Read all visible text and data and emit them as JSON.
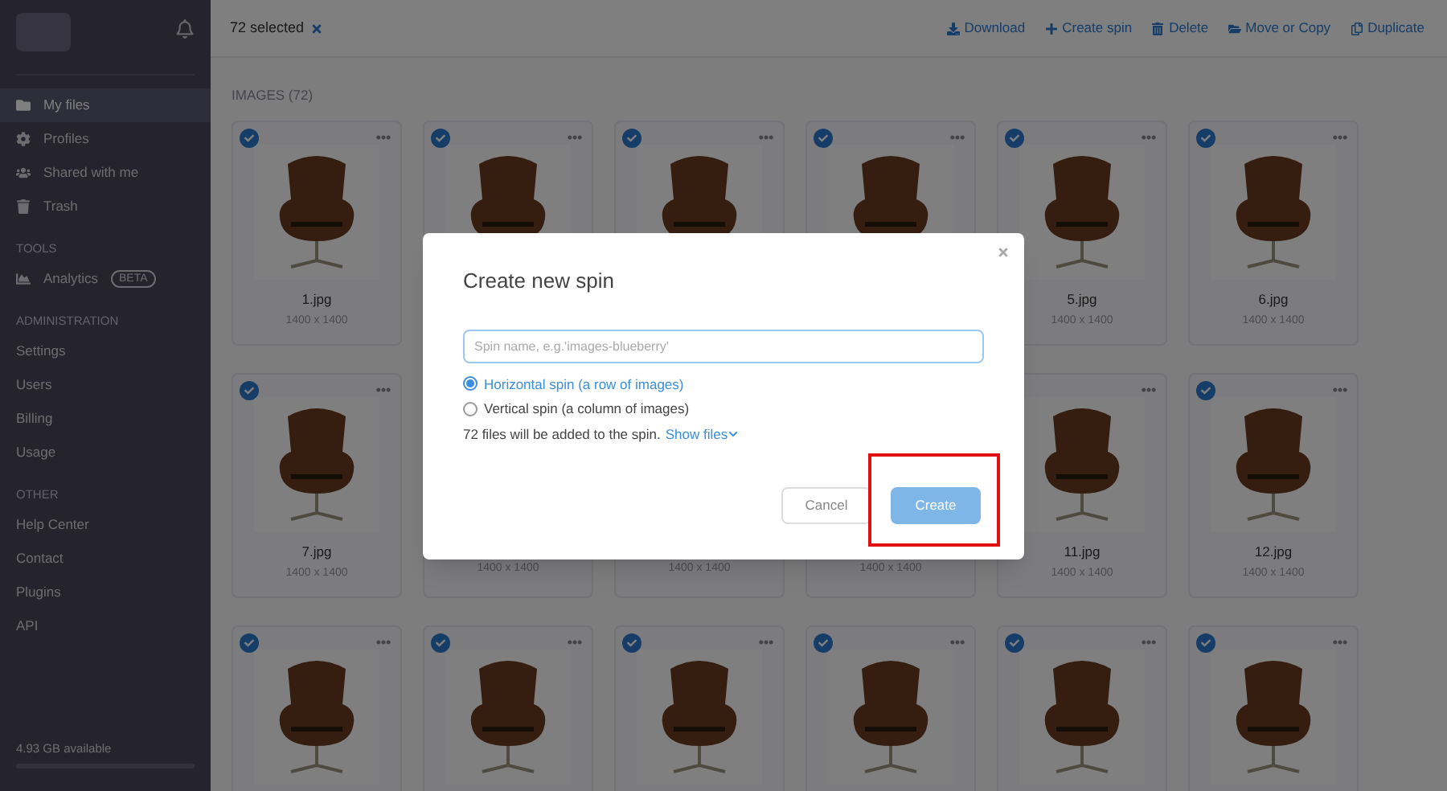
{
  "sidebar": {
    "nav": [
      {
        "label": "My files",
        "selected": true
      },
      {
        "label": "Profiles",
        "selected": false
      },
      {
        "label": "Shared with me",
        "selected": false
      },
      {
        "label": "Trash",
        "selected": false
      }
    ],
    "sections": [
      {
        "heading": "TOOLS",
        "items": [
          {
            "label": "Analytics",
            "badge": "BETA",
            "selected": false
          }
        ]
      },
      {
        "heading": "ADMINISTRATION",
        "items": [
          {
            "label": "Settings",
            "selected": false
          },
          {
            "label": "Users",
            "selected": false
          },
          {
            "label": "Billing",
            "selected": false
          },
          {
            "label": "Usage",
            "selected": false
          }
        ]
      },
      {
        "heading": "OTHER",
        "items": [
          {
            "label": "Help Center",
            "selected": false
          },
          {
            "label": "Contact",
            "selected": false
          },
          {
            "label": "Plugins",
            "selected": false
          },
          {
            "label": "API",
            "selected": false
          }
        ]
      }
    ],
    "storage": "4.93 GB available"
  },
  "toolbar": {
    "selection": "72 selected",
    "actions": [
      {
        "label": "Download"
      },
      {
        "label": "Create spin"
      },
      {
        "label": "Delete"
      },
      {
        "label": "Move or Copy"
      },
      {
        "label": "Duplicate"
      }
    ]
  },
  "gallery": {
    "heading": "IMAGES (72)",
    "cards": [
      {
        "name": "1.jpg",
        "size": "1400 x 1400",
        "selected": true
      },
      {
        "selected": true
      },
      {
        "selected": true
      },
      {
        "selected": true
      },
      {
        "name": "5.jpg",
        "size": "1400 x 1400",
        "selected": true
      },
      {
        "name": "6.jpg",
        "size": "1400 x 1400",
        "selected": true
      },
      {
        "name": "7.jpg",
        "size": "1400 x 1400",
        "selected": true
      },
      {
        "size": "1400 x 1400"
      },
      {
        "size": "1400 x 1400"
      },
      {
        "size": "1400 x 1400"
      },
      {
        "name": "11.jpg",
        "size": "1400 x 1400"
      },
      {
        "name": "12.jpg",
        "size": "1400 x 1400",
        "selected": true
      },
      {
        "selected": true
      },
      {
        "selected": true
      },
      {
        "selected": true
      },
      {
        "selected": true
      },
      {
        "selected": true
      },
      {
        "selected": true
      }
    ]
  },
  "dialog": {
    "title": "Create new spin",
    "name_field": {
      "placeholder": "Spin name, e.g.'images-blueberry'"
    },
    "options": [
      {
        "label": "Horizontal spin (a row of images)",
        "selected": true
      },
      {
        "label": "Vertical spin (a column of images)",
        "selected": false
      }
    ],
    "note": "72 files will be added to the spin.",
    "link": "Show files",
    "buttons": [
      {
        "label": "Cancel",
        "kind": "secondary",
        "disabled": false
      },
      {
        "label": "Create",
        "kind": "primary",
        "disabled": true,
        "highlighted": true
      }
    ]
  }
}
